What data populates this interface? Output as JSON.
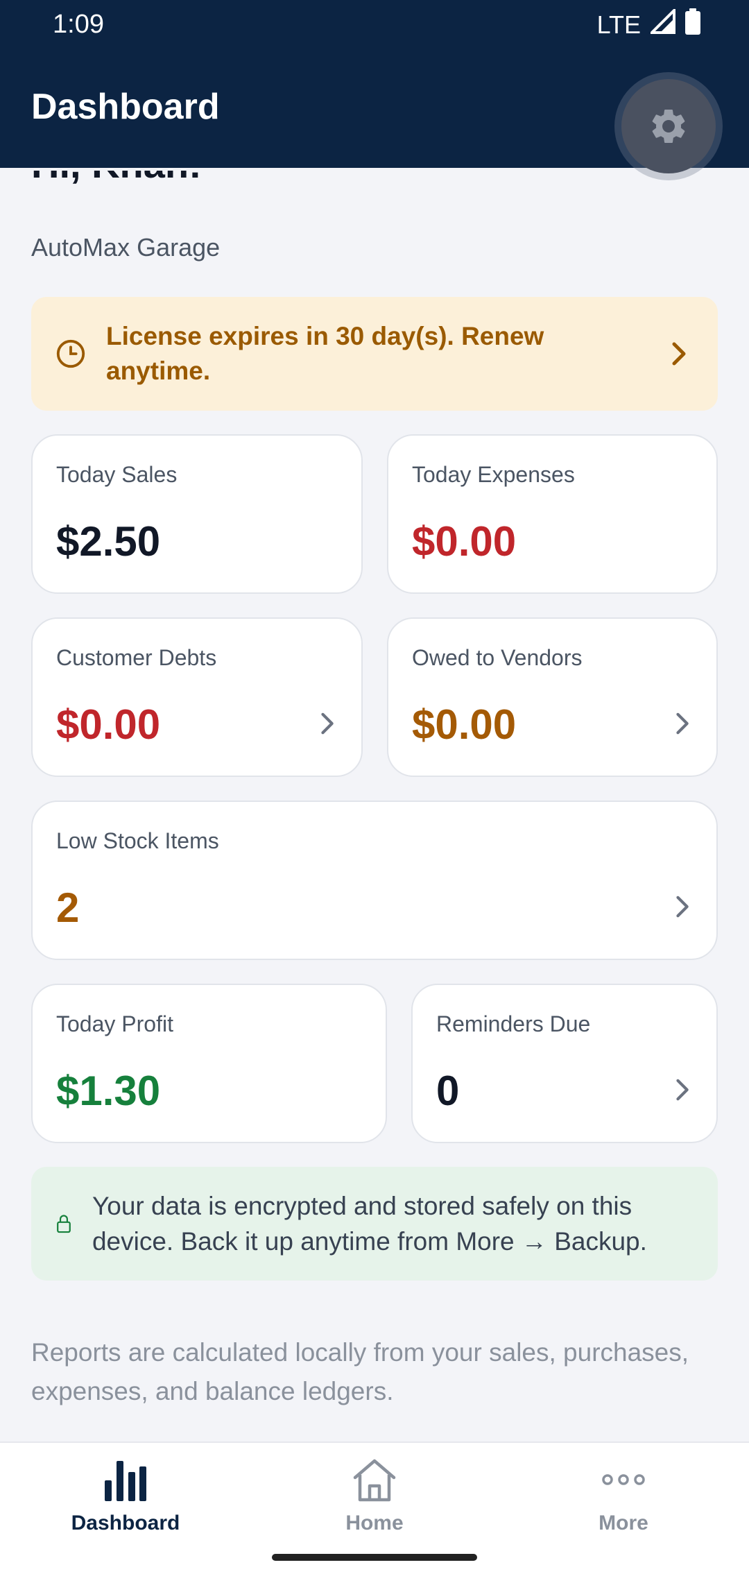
{
  "status_bar": {
    "time": "1:09",
    "network": "LTE"
  },
  "header": {
    "title": "Dashboard",
    "settings_icon": "gear-icon"
  },
  "greeting": {
    "text": "Hi, Khan!",
    "business_name": "AutoMax Garage"
  },
  "license_banner": {
    "text": "License expires in 30 day(s). Renew anytime.",
    "icon": "clock-icon"
  },
  "cards": {
    "today_sales": {
      "label": "Today Sales",
      "value": "$2.50"
    },
    "today_expenses": {
      "label": "Today Expenses",
      "value": "$0.00"
    },
    "customer_debts": {
      "label": "Customer Debts",
      "value": "$0.00"
    },
    "owed_vendors": {
      "label": "Owed to Vendors",
      "value": "$0.00"
    },
    "low_stock": {
      "label": "Low Stock Items",
      "value": "2"
    },
    "today_profit": {
      "label": "Today Profit",
      "value": "$1.30"
    },
    "reminders": {
      "label": "Reminders Due",
      "value": "0"
    }
  },
  "secure_banner": {
    "text": "Your data is encrypted and stored safely on this device. Back it up anytime from More → Backup.",
    "icon": "lock-icon"
  },
  "footer_note": "Reports are calculated locally from your sales, purchases, expenses, and balance ledgers.",
  "bottom_nav": [
    {
      "label": "Dashboard",
      "icon": "bar-chart-icon",
      "active": true
    },
    {
      "label": "Home",
      "icon": "home-icon",
      "active": false
    },
    {
      "label": "More",
      "icon": "more-dots-icon",
      "active": false
    }
  ],
  "colors": {
    "header_bg": "#0c2443",
    "negative": "#c0262b",
    "warning": "#a45a05",
    "positive": "#16803c",
    "neutral": "#111827"
  }
}
